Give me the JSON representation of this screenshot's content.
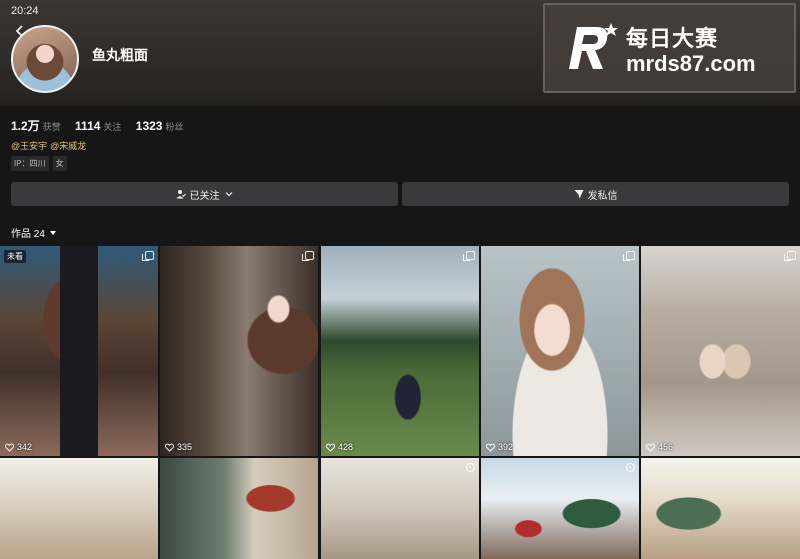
{
  "status_bar": {
    "time": "20:24"
  },
  "profile": {
    "username": "鱼丸粗面"
  },
  "watermark": {
    "brand_line1": "每日大赛",
    "brand_line2": "mrds87.com"
  },
  "stats": [
    {
      "value": "1.2万",
      "label": "获赞"
    },
    {
      "value": "1114",
      "label": "关注"
    },
    {
      "value": "1323",
      "label": "粉丝"
    }
  ],
  "mentions": [
    "@王安宇",
    "@宋威龙"
  ],
  "tags": [
    "IP：四川",
    "女"
  ],
  "actions": {
    "follow_label": "已关注",
    "message_label": "发私信"
  },
  "works": {
    "label": "作品 24"
  },
  "posts": [
    {
      "likes": "342",
      "badge": "未看",
      "type": "multi"
    },
    {
      "likes": "335",
      "badge": "",
      "type": "multi"
    },
    {
      "likes": "428",
      "badge": "",
      "type": "multi"
    },
    {
      "likes": "392",
      "badge": "",
      "type": "multi"
    },
    {
      "likes": "456",
      "badge": "",
      "type": "multi"
    },
    {
      "likes": "",
      "badge": "",
      "type": "none"
    },
    {
      "likes": "",
      "badge": "",
      "type": "none"
    },
    {
      "likes": "",
      "badge": "",
      "type": "live"
    },
    {
      "likes": "",
      "badge": "",
      "type": "live"
    },
    {
      "likes": "",
      "badge": "",
      "type": "none"
    }
  ],
  "colors": {
    "accent_mention": "#e7c46b",
    "button_bg": "#3a3a3c",
    "page_bg": "#161617"
  }
}
